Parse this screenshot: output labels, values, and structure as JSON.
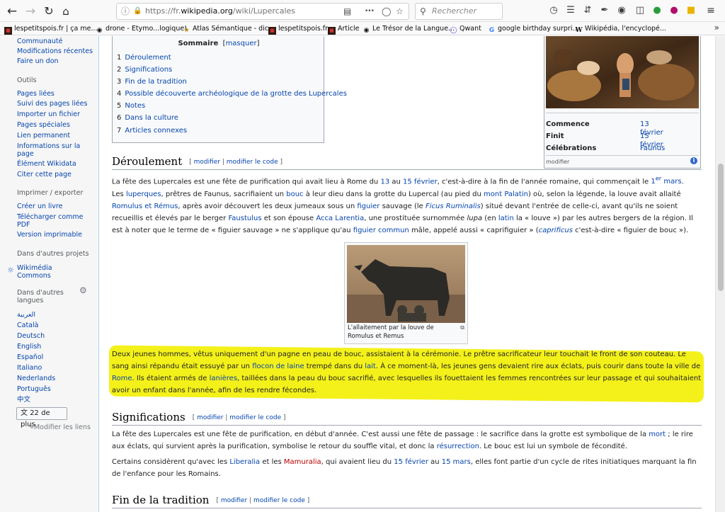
{
  "browser": {
    "url_prefix": "https://fr.",
    "url_domain": "wikipedia.org",
    "url_path": "/wiki/Lupercales",
    "search_placeholder": "Rechercher",
    "more_glyph": "•••",
    "bookmarks": [
      {
        "label": "lespetitspois.fr | ça me...",
        "icon": "lespetitspois-favicon"
      },
      {
        "label": "drone - Etymo...logique!",
        "icon": "cnrtl-favicon"
      },
      {
        "label": "Atlas Sémantique - dic...",
        "icon": "atlas-favicon"
      },
      {
        "label": "lespetitspois.fr",
        "icon": "lespetitspois-favicon"
      },
      {
        "label": "Article",
        "icon": "lespetitspois-favicon"
      },
      {
        "label": "Le Trésor de la Langue...",
        "icon": "cnrtl-favicon"
      },
      {
        "label": "Qwant",
        "icon": "qwant-favicon"
      },
      {
        "label": "google birthday surpri...",
        "icon": "google-favicon"
      },
      {
        "label": "Wikipédia, l'encyclopé...",
        "icon": "wikipedia-favicon"
      }
    ]
  },
  "sidebar": {
    "top_links": [
      "Communauté",
      "Modifications récentes",
      "Faire un don"
    ],
    "tools_heading": "Outils",
    "tools": [
      "Pages liées",
      "Suivi des pages liées",
      "Importer un fichier",
      "Pages spéciales",
      "Lien permanent",
      "Informations sur la page",
      "Élément Wikidata",
      "Citer cette page"
    ],
    "print_heading": "Imprimer / exporter",
    "print": [
      "Créer un livre",
      "Télécharger comme PDF",
      "Version imprimable"
    ],
    "projects_heading": "Dans d'autres projets",
    "projects": [
      "Wikimédia Commons"
    ],
    "langs_heading": "Dans d'autres langues",
    "langs": [
      "العربية",
      "Català",
      "Deutsch",
      "English",
      "Español",
      "Italiano",
      "Nederlands",
      "Português",
      "中文"
    ],
    "more_langs": "22 de plus",
    "edit_links": "Modifier les liens"
  },
  "toc": {
    "title": "Sommaire",
    "toggle": "masquer",
    "items": [
      {
        "num": "1",
        "label": "Déroulement"
      },
      {
        "num": "2",
        "label": "Significations"
      },
      {
        "num": "3",
        "label": "Fin de la tradition"
      },
      {
        "num": "4",
        "label": "Possible découverte archéologique de la grotte des Lupercales"
      },
      {
        "num": "5",
        "label": "Notes"
      },
      {
        "num": "6",
        "label": "Dans la culture"
      },
      {
        "num": "7",
        "label": "Articles connexes"
      }
    ]
  },
  "infobox": {
    "rows": [
      {
        "label": "Commence",
        "value": "13 février"
      },
      {
        "label": "Finit",
        "value": "15 février"
      },
      {
        "label": "Célébrations",
        "value": "Faunus"
      }
    ],
    "edit": "modifier",
    "info_glyph": "i"
  },
  "sections": {
    "edit_label": "modifier",
    "edit_code_label": "modifier le code",
    "deroulement": "Déroulement",
    "significations": "Significations",
    "fin": "Fin de la tradition"
  },
  "thumb": {
    "caption": "L'allaitement par la louve de Romulus et Remus"
  }
}
